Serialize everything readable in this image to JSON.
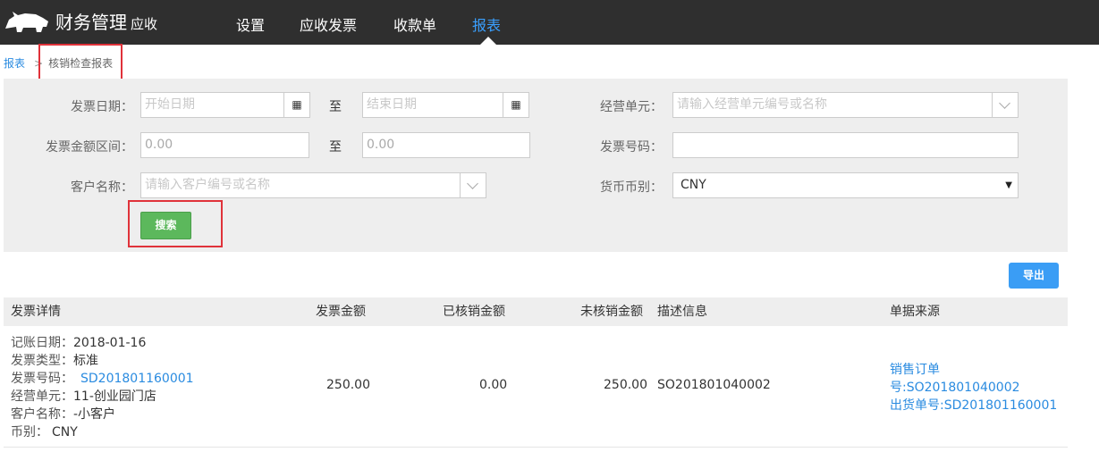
{
  "header": {
    "brand": "财务管理",
    "brand_sub": "应收",
    "nav": [
      "设置",
      "应收发票",
      "收款单",
      "报表"
    ],
    "active_nav": "报表"
  },
  "breadcrumb": {
    "root": "报表",
    "separator": ">",
    "current": "核销检查报表"
  },
  "filters": {
    "invoice_date_label": "发票日期：",
    "start_date_placeholder": "开始日期",
    "to_label": "至",
    "end_date_placeholder": "结束日期",
    "business_unit_label": "经营单元：",
    "business_unit_placeholder": "请输入经营单元编号或名称",
    "amount_range_label": "发票金额区间：",
    "amount_min_placeholder": "0.00",
    "amount_max_placeholder": "0.00",
    "invoice_no_label": "发票号码：",
    "invoice_no_value": "",
    "customer_label": "客户名称：",
    "customer_placeholder": "请输入客户编号或名称",
    "currency_label": "货币币别：",
    "currency_value": "CNY",
    "search_button": "搜索"
  },
  "export_button": "导出",
  "table": {
    "columns": [
      "发票详情",
      "发票金额",
      "已核销金额",
      "未核销金额",
      "描述信息",
      "单据来源"
    ],
    "rows": [
      {
        "details": [
          {
            "label": "记账日期：",
            "value": "2018-01-16"
          },
          {
            "label": "发票类型：",
            "value": "标准"
          },
          {
            "label": "发票号码：",
            "value": "SD201801160001"
          },
          {
            "label": "经营单元：",
            "value": "11-创业园门店"
          },
          {
            "label": "客户名称：",
            "value": "-小客户"
          },
          {
            "label": "币别：",
            "value": "CNY"
          }
        ],
        "invoice_amount": "250.00",
        "written_off": "0.00",
        "remaining": "250.00",
        "description": "SO201801040002",
        "source_lines": [
          "销售订单",
          "号:SO201801040002",
          "出货单号:SD201801160001"
        ]
      }
    ]
  },
  "colors": {
    "topbar": "#2f2f2f",
    "active_nav": "#3aa0ff",
    "link": "#2a8be0",
    "search_button": "#5cb85c",
    "export_button": "#3a9df5",
    "highlight_box": "#e0323a"
  }
}
